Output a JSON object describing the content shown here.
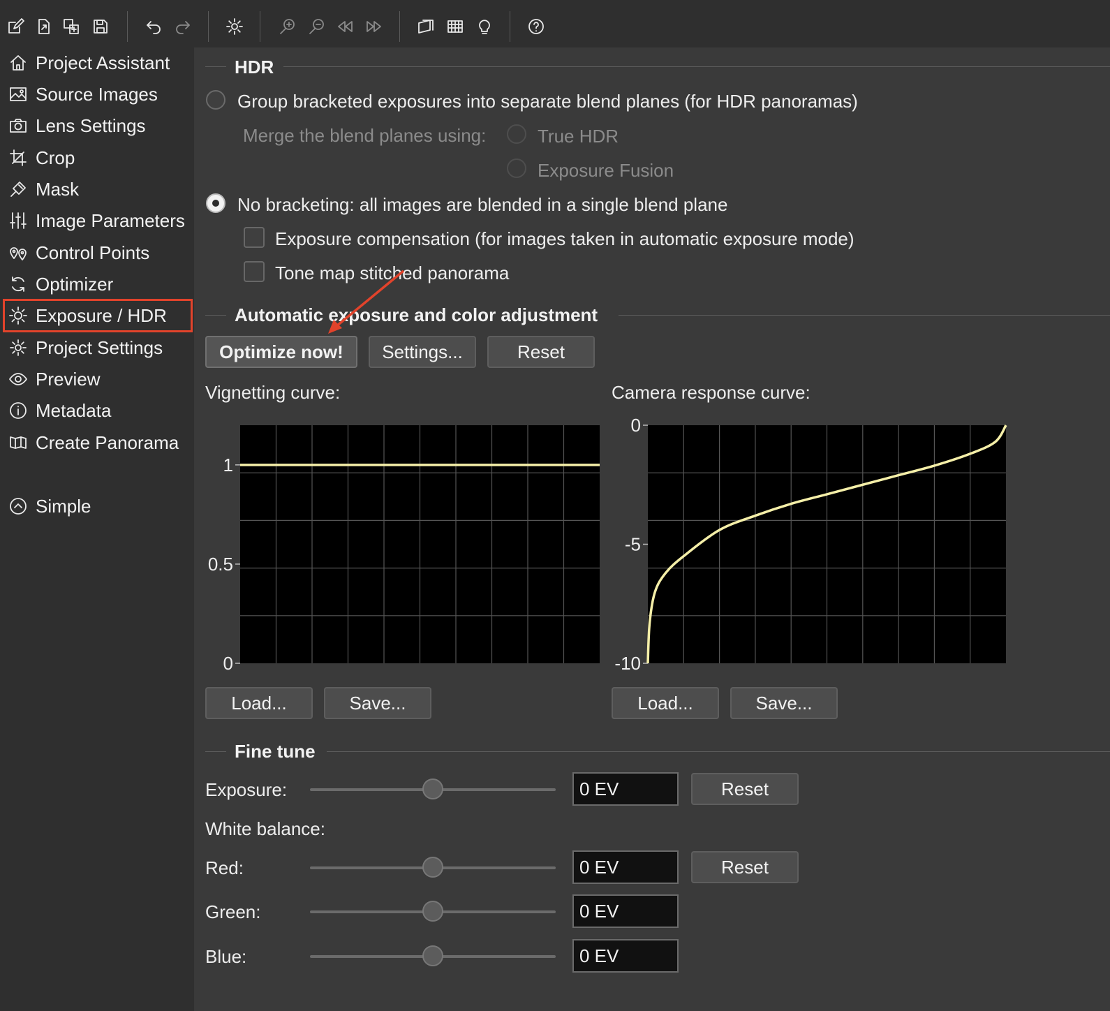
{
  "toolbar": {
    "icons": [
      "new-project-icon",
      "open-project-icon",
      "add-images-icon",
      "save-icon",
      "undo-icon",
      "redo-icon",
      "preferences-gear-icon",
      "zoom-in-icon",
      "zoom-out-icon",
      "step-back-icon",
      "step-forward-icon",
      "panorama-preview-icon",
      "grid-icon",
      "tip-bulb-icon",
      "help-icon"
    ]
  },
  "sidebar": {
    "items": [
      {
        "label": "Project Assistant",
        "icon": "home-icon"
      },
      {
        "label": "Source Images",
        "icon": "image-icon"
      },
      {
        "label": "Lens Settings",
        "icon": "camera-icon"
      },
      {
        "label": "Crop",
        "icon": "crop-icon"
      },
      {
        "label": "Mask",
        "icon": "brush-icon"
      },
      {
        "label": "Image Parameters",
        "icon": "sliders-icon"
      },
      {
        "label": "Control Points",
        "icon": "pin-icon"
      },
      {
        "label": "Optimizer",
        "icon": "refresh-icon"
      },
      {
        "label": "Exposure / HDR",
        "icon": "sun-icon",
        "active": true
      },
      {
        "label": "Project Settings",
        "icon": "gear-icon"
      },
      {
        "label": "Preview",
        "icon": "eye-icon"
      },
      {
        "label": "Metadata",
        "icon": "info-icon"
      },
      {
        "label": "Create Panorama",
        "icon": "panorama-icon"
      }
    ],
    "mode": {
      "label": "Simple",
      "icon": "chevron-up-circle-icon"
    }
  },
  "hdr": {
    "title": "HDR",
    "group_option": "Group bracketed exposures into separate blend planes (for HDR panoramas)",
    "merge_label": "Merge the blend planes using:",
    "true_hdr": "True HDR",
    "exposure_fusion": "Exposure Fusion",
    "no_bracketing_option": "No bracketing: all images are blended in a single blend plane",
    "exposure_compensation": "Exposure compensation (for images taken in automatic exposure mode)",
    "tone_map": "Tone map stitched panorama",
    "selected": "no_bracketing"
  },
  "auto": {
    "title": "Automatic exposure and color adjustment",
    "optimize_label": "Optimize now!",
    "settings_label": "Settings...",
    "reset_label": "Reset"
  },
  "curves": {
    "vignetting_label": "Vignetting curve:",
    "camera_label": "Camera response curve:",
    "load_label": "Load...",
    "save_label": "Save..."
  },
  "chart_data": [
    {
      "type": "line",
      "title": "Vignetting curve:",
      "ylim": [
        0,
        1.2
      ],
      "yticks": [
        "1",
        "0.5",
        "0"
      ],
      "ytick_values": [
        1,
        0.5,
        0
      ],
      "xlim": [
        0,
        1
      ],
      "x": [
        0,
        1
      ],
      "y": [
        1,
        1
      ],
      "line_color": "#f5efa8",
      "grid": true
    },
    {
      "type": "line",
      "title": "Camera response curve:",
      "ylim": [
        -10,
        0
      ],
      "yticks": [
        "0",
        "-5",
        "-10"
      ],
      "ytick_values": [
        0,
        -5,
        -10
      ],
      "xlim": [
        0,
        1
      ],
      "x": [
        0,
        0.005,
        0.02,
        0.05,
        0.1,
        0.2,
        0.3,
        0.4,
        0.5,
        0.6,
        0.7,
        0.8,
        0.9,
        0.97,
        1
      ],
      "y": [
        -10,
        -8.3,
        -7.0,
        -6.2,
        -5.5,
        -4.4,
        -3.8,
        -3.3,
        -2.9,
        -2.5,
        -2.1,
        -1.7,
        -1.2,
        -0.7,
        0
      ],
      "line_color": "#f5efa8",
      "grid": true
    }
  ],
  "fine_tune": {
    "title": "Fine tune",
    "exposure_label": "Exposure:",
    "white_balance_label": "White balance:",
    "red_label": "Red:",
    "green_label": "Green:",
    "blue_label": "Blue:",
    "exposure_value": "0 EV",
    "red_value": "0 EV",
    "green_value": "0 EV",
    "blue_value": "0 EV",
    "reset_label": "Reset",
    "slider_level": 0.5
  }
}
